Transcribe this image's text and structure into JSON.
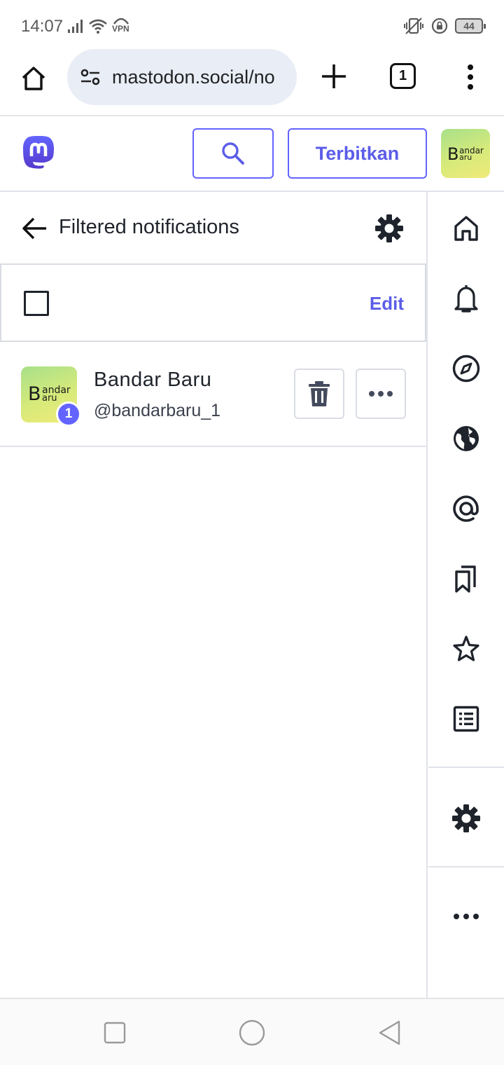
{
  "status_bar": {
    "time": "14:07",
    "vpn_label": "VPN",
    "battery_level": "44"
  },
  "browser": {
    "url": "mastodon.social/no",
    "tab_count": "1"
  },
  "header": {
    "publish_label": "Terbitkan",
    "avatar_letter": "B",
    "avatar_line1": "andar",
    "avatar_line2": "aru"
  },
  "column": {
    "title": "Filtered notifications",
    "edit_label": "Edit"
  },
  "notification_requests": [
    {
      "display_name": "Bandar Baru",
      "handle": "@bandarbaru_1",
      "count": "1",
      "avatar_letter": "B",
      "avatar_line1": "andar",
      "avatar_line2": "aru"
    }
  ],
  "nav_rail": {
    "items": [
      "home-icon",
      "bell-icon",
      "compass-icon",
      "globe-icon",
      "at-icon",
      "bookmarks-icon",
      "star-icon",
      "list-icon",
      "gear-icon",
      "more-icon"
    ]
  },
  "colors": {
    "accent": "#6364ff",
    "accent_text": "#5b5de8",
    "text": "#1f232b",
    "border": "#e0e3ea"
  }
}
